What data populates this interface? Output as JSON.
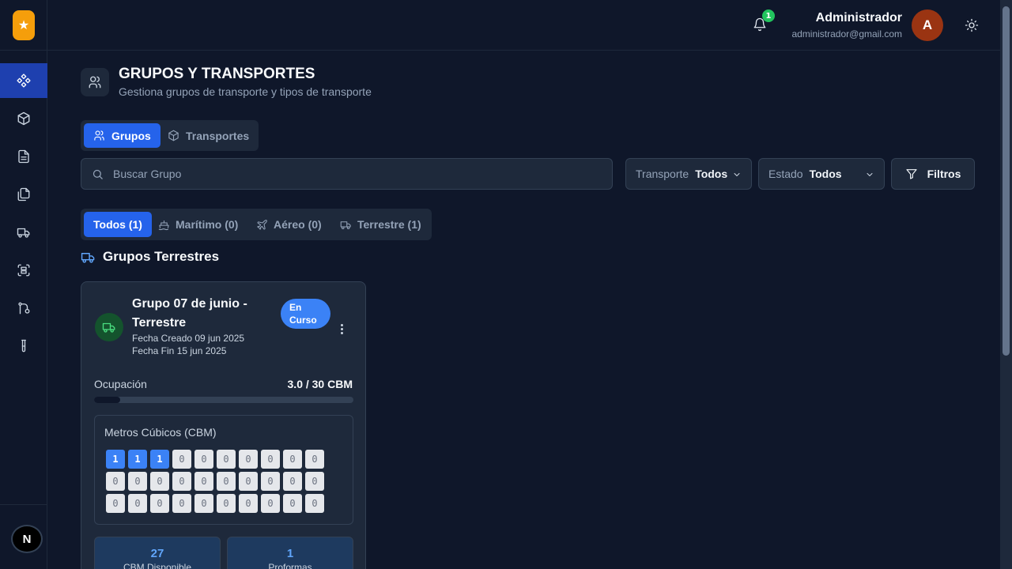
{
  "topbar": {
    "notification_count": "1",
    "user_name": "Administrador",
    "user_email": "administrador@gmail.com",
    "avatar_initial": "A"
  },
  "sidebar": {
    "items": [
      {
        "icon": "dashboard-icon"
      },
      {
        "icon": "package-icon"
      },
      {
        "icon": "document-icon"
      },
      {
        "icon": "files-icon"
      },
      {
        "icon": "truck-icon"
      },
      {
        "icon": "scan-icon"
      },
      {
        "icon": "git-icon"
      },
      {
        "icon": "test-tube-icon"
      }
    ],
    "footer_badge": "N"
  },
  "header": {
    "title": "GRUPOS Y TRANSPORTES",
    "subtitle": "Gestiona grupos de transporte y tipos de transporte"
  },
  "tabs": {
    "grupos": "Grupos",
    "transportes": "Transportes"
  },
  "search": {
    "placeholder": "Buscar Grupo"
  },
  "filters": {
    "transporte_label": "Transporte",
    "transporte_value": "Todos",
    "estado_label": "Estado",
    "estado_value": "Todos",
    "filtros_label": "Filtros"
  },
  "categories": {
    "todos": "Todos (1)",
    "maritimo": "Marítimo (0)",
    "aereo": "Aéreo (0)",
    "terrestre": "Terrestre (1)"
  },
  "section": {
    "title": "Grupos Terrestres"
  },
  "card": {
    "title": "Grupo 07 de junio - Terrestre",
    "created": "Fecha Creado 09 jun 2025",
    "ends": "Fecha Fin 15 jun 2025",
    "status": "En Curso",
    "occupancy_label": "Ocupación",
    "occupancy_value": "3.0 / 30 CBM",
    "occupancy_fraction": 0.1,
    "cbm_title": "Metros Cúbicos (CBM)",
    "cbm_cells": [
      1,
      1,
      1,
      0,
      0,
      0,
      0,
      0,
      0,
      0,
      0,
      0,
      0,
      0,
      0,
      0,
      0,
      0,
      0,
      0,
      0,
      0,
      0,
      0,
      0,
      0,
      0,
      0,
      0,
      0
    ],
    "stat_available_value": "27",
    "stat_available_label": "CBM Disponible",
    "stat_proformas_value": "1",
    "stat_proformas_label": "Proformas"
  },
  "colors": {
    "accent": "#2563eb",
    "logo": "#f59e0b",
    "success": "#22c55e",
    "avatar": "#9a3412"
  }
}
